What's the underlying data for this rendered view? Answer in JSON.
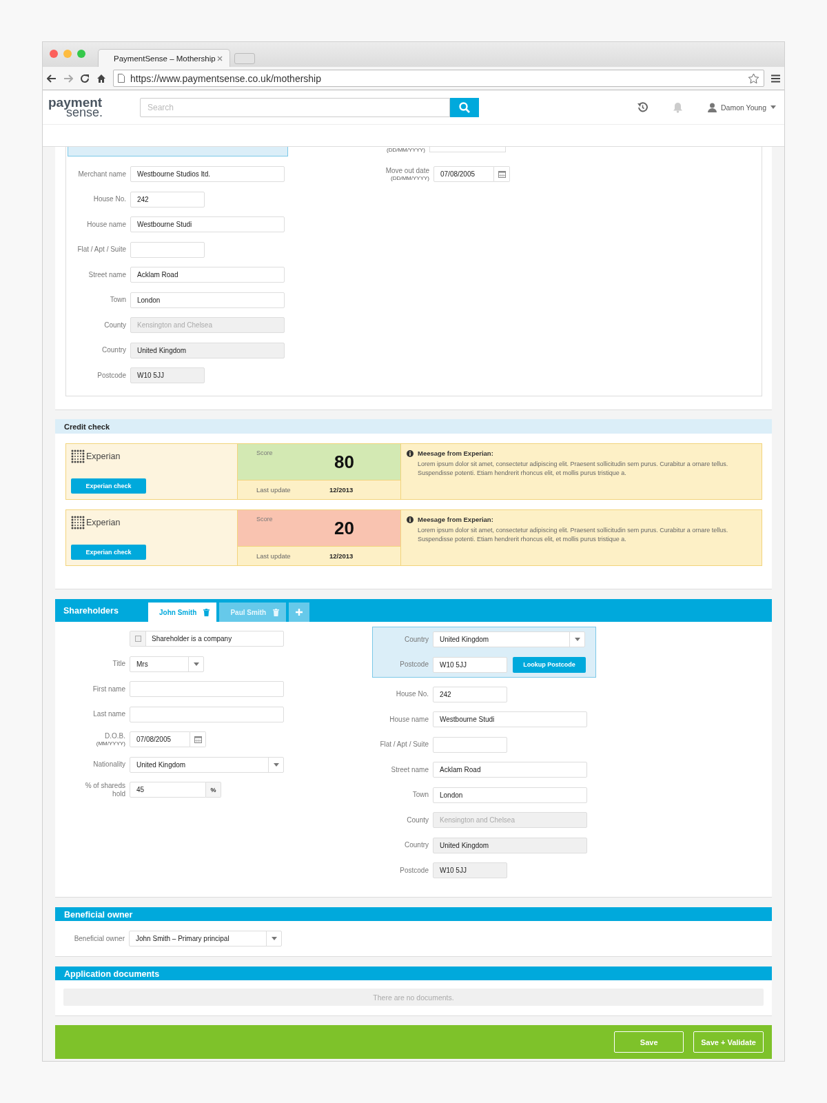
{
  "browser": {
    "tab_title": "PaymentSense – Mothership",
    "url": "https://www.paymentsense.co.uk/mothership"
  },
  "header": {
    "logo_top": "payment",
    "logo_bottom": "sense.",
    "search_placeholder": "Search",
    "user_name": "Damon Young"
  },
  "address": {
    "cut_label": "(DD/MM/YYYY)",
    "fields": [
      {
        "label": "Merchant name",
        "kind": "text",
        "short": false,
        "value": "Westbourne Studios ltd.",
        "disabled": false
      },
      {
        "label": "House No.",
        "kind": "text",
        "short": true,
        "value": "242",
        "disabled": false
      },
      {
        "label": "House name",
        "kind": "text",
        "short": false,
        "value": "Westbourne Studi",
        "disabled": false
      },
      {
        "label": "Flat / Apt / Suite",
        "kind": "text",
        "short": true,
        "disabled": false
      },
      {
        "label": "Street name",
        "kind": "text",
        "short": false,
        "value": "Acklam Road",
        "disabled": false
      },
      {
        "label": "Town",
        "kind": "text",
        "short": false,
        "value": "London",
        "disabled": false
      },
      {
        "label": "County",
        "kind": "readonly",
        "short": false,
        "value": "Kensington and Chelsea",
        "disabled": true
      },
      {
        "label": "Country",
        "kind": "readonly",
        "short": false,
        "value": "United Kingdom",
        "disabled": false
      },
      {
        "label": "Postcode",
        "kind": "readonly",
        "short": true,
        "value": "W10 5JJ",
        "disabled": false
      }
    ],
    "side_fields": [
      {
        "label": "Move out date",
        "sublabel": "(DD/MM/YYYY)",
        "kind": "date",
        "value": "07/08/2005",
        "disabled": false
      }
    ]
  },
  "credit_check": {
    "title": "Credit check",
    "results": [
      {
        "brand": "Experian",
        "button": "Experian check",
        "score_label": "Score",
        "score": "80",
        "color": "#d3e9b3",
        "update_label": "Last update",
        "update": "12/2013",
        "message_title": "Meesage from Experian:",
        "message": "Lorem ipsum dolor sit amet, consectetur adipiscing elit. Praesent sollicitudin sem purus. Curabitur a ornare tellus. Suspendisse potenti. Etiam hendrerit rhoncus elit, et mollis purus tristique a."
      },
      {
        "brand": "Experian",
        "button": "Experian check",
        "score_label": "Score",
        "score": "20",
        "color": "#f9c3b0",
        "update_label": "Last update",
        "update": "12/2013",
        "message_title": "Meesage from Experian:",
        "message": "Lorem ipsum dolor sit amet, consectetur adipiscing elit. Praesent sollicitudin sem purus. Curabitur a ornare tellus. Suspendisse potenti. Etiam hendrerit rhoncus elit, et mollis purus tristique a."
      }
    ]
  },
  "shareholders": {
    "title": "Shareholders",
    "tabs": [
      {
        "label": "John Smith",
        "selected": true
      },
      {
        "label": "Paul Smith",
        "selected": false
      }
    ],
    "left_fields": [
      {
        "kind": "checkbox",
        "short": false,
        "text": "Shareholder is a company",
        "checked": false,
        "disabled": false
      },
      {
        "label": "Title",
        "kind": "select",
        "short": true,
        "value": "Mrs",
        "disabled": false
      },
      {
        "label": "First name",
        "kind": "text",
        "short": false,
        "disabled": false
      },
      {
        "label": "Last name",
        "kind": "text",
        "short": false,
        "disabled": false
      },
      {
        "label": "D.O.B.",
        "sublabel": "(MM/YYYY)",
        "kind": "date",
        "value": "07/08/2005",
        "disabled": false
      },
      {
        "label": "Nationality",
        "kind": "select",
        "short": false,
        "value": "United Kingdom",
        "disabled": false
      },
      {
        "label": "% of shareds hold",
        "kind": "percent",
        "value": "45",
        "addon": "%",
        "disabled": false
      }
    ],
    "lookup": {
      "country_label": "Country",
      "country": "United Kingdom",
      "postcode_label": "Postcode",
      "postcode": "W10 5JJ",
      "button": "Lookup Postcode"
    },
    "right_fields": [
      {
        "label": "House No.",
        "kind": "text",
        "short": true,
        "value": "242",
        "disabled": false
      },
      {
        "label": "House name",
        "kind": "text",
        "short": false,
        "value": "Westbourne Studi",
        "disabled": false
      },
      {
        "label": "Flat / Apt / Suite",
        "kind": "text",
        "short": true,
        "disabled": false
      },
      {
        "label": "Street name",
        "kind": "text",
        "short": false,
        "value": "Acklam Road",
        "disabled": false
      },
      {
        "label": "Town",
        "kind": "text",
        "short": false,
        "value": "London",
        "disabled": false
      },
      {
        "label": "County",
        "kind": "readonly",
        "short": false,
        "value": "Kensington and Chelsea",
        "disabled": true
      },
      {
        "label": "Country",
        "kind": "readonly",
        "short": false,
        "value": "United Kingdom",
        "disabled": false
      },
      {
        "label": "Postcode",
        "kind": "readonly",
        "short": true,
        "value": "W10 5JJ",
        "disabled": false
      }
    ]
  },
  "beneficial_owner": {
    "title": "Beneficial owner",
    "label": "Beneficial owner",
    "value": "John Smith – Primary principal"
  },
  "documents": {
    "title": "Application documents",
    "empty_text": "There are no documents."
  },
  "actions": [
    "Save",
    "Save + Validate"
  ]
}
